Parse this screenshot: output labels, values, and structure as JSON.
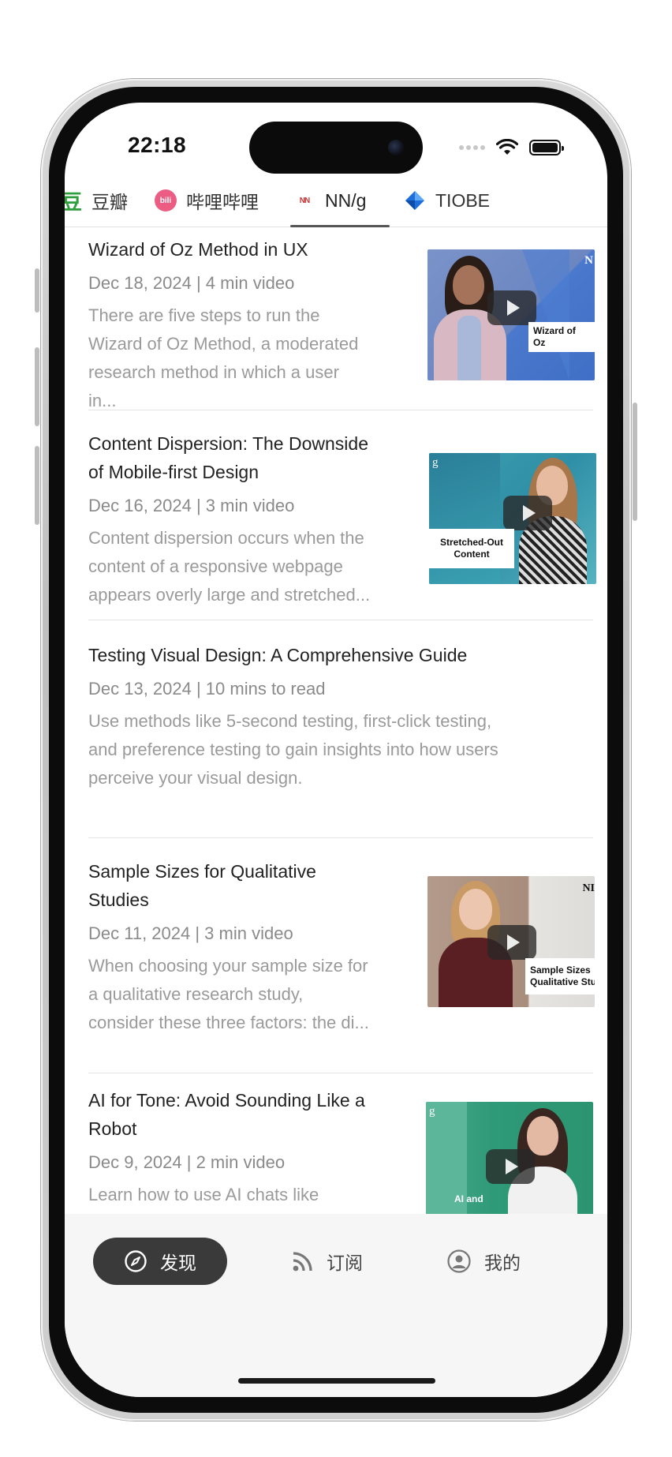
{
  "status_bar": {
    "time": "22:18"
  },
  "source_tabs": [
    {
      "label": "豆瓣",
      "icon": "douban-icon",
      "glyph": "豆"
    },
    {
      "label": "哔哩哔哩",
      "icon": "bilibili-icon",
      "glyph": "bili"
    },
    {
      "label": "NN/g",
      "icon": "nng-icon",
      "glyph": "NN"
    },
    {
      "label": "TIOBE",
      "icon": "tiobe-icon",
      "glyph": ""
    }
  ],
  "active_tab": "NN/g",
  "articles": [
    {
      "title": "Wizard of Oz Method in UX",
      "meta": "Dec 18, 2024 | 4 min video",
      "desc_lines": [
        "There are five steps to run the",
        "Wizard of Oz Method, a moderated",
        "research method in which a user in..."
      ],
      "thumb_label": "Wizard of Oz",
      "thumb_mark": "N"
    },
    {
      "title_lines": [
        "Content Dispersion: The Downside",
        "of Mobile-first Design"
      ],
      "meta": "Dec 16, 2024 | 3 min video",
      "desc_lines": [
        "Content dispersion occurs when the",
        "content of a responsive webpage",
        "appears overly large and stretched..."
      ],
      "thumb_label_lines": [
        "Stretched-Out",
        "Content"
      ],
      "thumb_mark": "g"
    },
    {
      "title": "Testing Visual Design: A Comprehensive Guide",
      "meta": "Dec 13, 2024 | 10 mins to read",
      "desc_lines": [
        "Use methods like 5-second testing, first-click testing,",
        "and preference testing to gain insights into how users",
        "perceive your visual design."
      ]
    },
    {
      "title_lines": [
        "Sample Sizes for Qualitative",
        "Studies"
      ],
      "meta": "Dec 11, 2024 | 3 min video",
      "desc_lines": [
        "When choosing your sample size for",
        "a qualitative research study,",
        "consider these three factors: the di..."
      ],
      "thumb_label_lines": [
        "Sample Sizes",
        "Qualitative Stu"
      ],
      "thumb_mark": "NI"
    },
    {
      "title_lines": [
        "AI for Tone: Avoid Sounding Like a",
        "Robot"
      ],
      "meta": "Dec 9, 2024 | 2 min video",
      "desc_lines": [
        "Learn how to use AI chats like"
      ],
      "thumb_label": "AI and",
      "thumb_mark": "g"
    }
  ],
  "bottom_nav": [
    {
      "label": "发现",
      "icon": "compass-icon"
    },
    {
      "label": "订阅",
      "icon": "rss-icon"
    },
    {
      "label": "我的",
      "icon": "profile-icon"
    }
  ],
  "active_nav": "发现",
  "colors": {
    "douban_green": "#2f9e3c",
    "bilibili_pink": "#ec5d84",
    "tiobe_blue": "#1e6fd9",
    "nav_active_bg": "#3a3a3a"
  }
}
